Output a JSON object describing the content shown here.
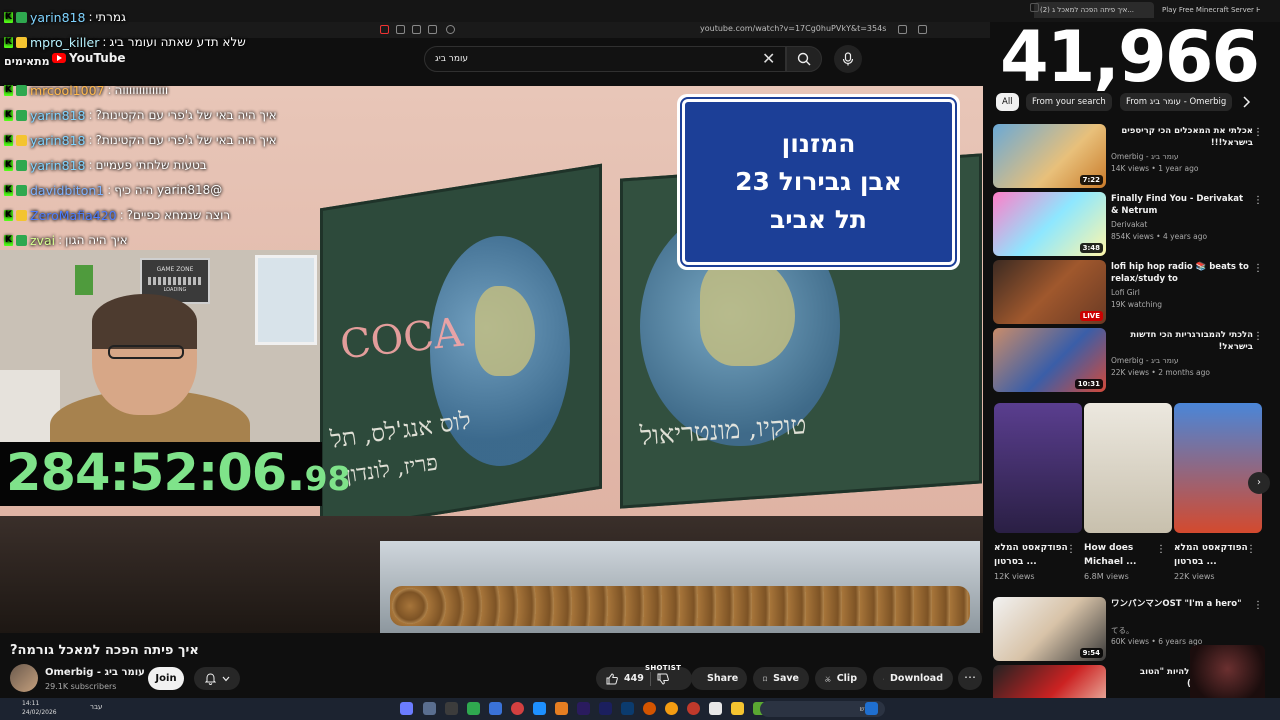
{
  "browser": {
    "url": "youtube.com/watch?v=17Cg0huPVkY&t=354s",
    "tabs": [
      {
        "label": "(2) איך פיתה הפכה למאכל ג..."
      },
      {
        "label": "Play Free Minecraft Server Hosting"
      }
    ]
  },
  "header": {
    "logo_text": "YouTube",
    "search_value": "עומר ביג",
    "search_placeholder": "Search"
  },
  "overlay": {
    "big_counter": "41,966",
    "timer_main": "284:52:06.",
    "timer_frac": "98",
    "side_label": "מתאימים"
  },
  "chat": [
    {
      "user": "yarin818",
      "message": "גמרתי",
      "user_color": "#7fd3ff"
    },
    {
      "user": "mpro_killer",
      "message": "שלא תדע שאתה ועומר ביג",
      "user_color": "#b7f3ff"
    },
    {
      "user": "mrcool1007",
      "message": "ווווווווווווווה",
      "user_color": "#ffb84d"
    },
    {
      "user": "yarin818",
      "message": "איך היה באי של ג'פרי עם הקטינות?",
      "user_color": "#7fd3ff"
    },
    {
      "user": "yarin818",
      "message": "איך היה באי של ג'פרי עם הקטינות?",
      "user_color": "#7fd3ff"
    },
    {
      "user": "yarin818",
      "message": "בטעות שלחתי פעמיים",
      "user_color": "#7fd3ff"
    },
    {
      "user": "davidbiton1",
      "message": "@yarin818 היה כיף",
      "user_color": "#7fb2ff"
    },
    {
      "user": "ZeroMafia420",
      "message": "רוצה שנמחא כפיים?",
      "user_color": "#4d7dff"
    },
    {
      "user": "zvai",
      "message": "איך היה הגון",
      "user_color": "#d6ff8f"
    }
  ],
  "sign": {
    "line1": "המזנון",
    "line2": "אבן גבירול 23",
    "line3": "תל אביב"
  },
  "chalk": {
    "city_left": "לוס אנג'לס, תל",
    "city_left2": "פריז, לונדון",
    "city_right": "טוקיו, מונטריאול",
    "logo": "COCA"
  },
  "webcam": {
    "box_label": "GAME ZONE",
    "box_sub": "LOADING"
  },
  "video": {
    "title": "איך פיתה הפכה למאכל גורמה?",
    "channel": "Omerbig - עומר ביג",
    "subscribers": "29.1K subscribers",
    "join_label": "Join",
    "like_count": "449",
    "share_label": "Share",
    "save_label": "Save",
    "clip_label": "Clip",
    "download_label": "Download",
    "shotist_label": "SHOTIST"
  },
  "chips": [
    {
      "label": "All"
    },
    {
      "label": "From your search"
    },
    {
      "label": "From עומר ביג - Omerbig"
    }
  ],
  "recommendations": [
    {
      "title": "אכלתי את המאכלים הכי קריספים בישראל!!!",
      "channel": "Omerbig - עומר ביג",
      "meta": "14K views • 1 year ago",
      "duration": "7:22",
      "rtl": true,
      "thumb": "linear-gradient(135deg,#6aa9d6,#e8c07a 60%,#c97a2a)"
    },
    {
      "title": "Finally Find You - Derivakat & Netrum",
      "channel": "Derivakat",
      "meta": "854K views • 4 years ago",
      "duration": "3:48",
      "rtl": false,
      "thumb": "linear-gradient(135deg,#ff7ec8,#8de7ff 50%,#fff6a8)"
    },
    {
      "title": "lofi hip hop radio 📚 beats to relax/study to",
      "channel": "Lofi Girl",
      "meta": "19K watching",
      "duration": "LIVE",
      "rtl": false,
      "thumb": "linear-gradient(135deg,#3b2a22,#a0582d 50%,#6a3a24)"
    },
    {
      "title": "הלכתי להמבורגריות הכי חדשות בישראל!",
      "channel": "Omerbig - עומר ביג",
      "meta": "22K views • 2 months ago",
      "duration": "10:31",
      "rtl": true,
      "thumb": "linear-gradient(135deg,#c98c6a,#3a5ea8 55%,#d34a3a)"
    }
  ],
  "shorts": [
    {
      "title": "הפודקאסט המלא בסרטון ...",
      "views": "12K views",
      "thumb": "linear-gradient(180deg,#5a3e8f,#2a1f44)"
    },
    {
      "title": "How does Michael ...",
      "views": "6.8M views",
      "thumb": "linear-gradient(180deg,#ece8df,#c8c0ad)"
    },
    {
      "title": "הפודקאסט המלא בסרטון ...",
      "views": "22K views",
      "thumb": "linear-gradient(180deg,#4a86d8,#d44a2e)"
    }
  ],
  "more_recs": [
    {
      "title": "ワンパンマンOST \"I'm a hero\"",
      "channel": "てる。",
      "meta": "60K views • 6 years ago",
      "duration": "9:54",
      "rtl": false,
      "thumb": "linear-gradient(135deg,#f2f2f2,#d8c3a8 50%,#3a3a3a)"
    },
    {
      "title": "זאת הפכה אותי להיות \"הטוב בארץ\" (בשארה)",
      "channel": "",
      "meta": "",
      "duration": "",
      "rtl": true,
      "thumb": "linear-gradient(135deg,#222,#c22 50%,#f4e6d1)"
    }
  ],
  "taskbar": {
    "search_placeholder": "חיפוש",
    "clock_time": "14:11",
    "clock_date": "24/02/2026",
    "lang": "עבר"
  },
  "colors": {
    "timer": "#7fe38a",
    "kick_green": "#53fc18",
    "youtube_red": "#ff0000",
    "sign_blue": "#1c3f97"
  }
}
